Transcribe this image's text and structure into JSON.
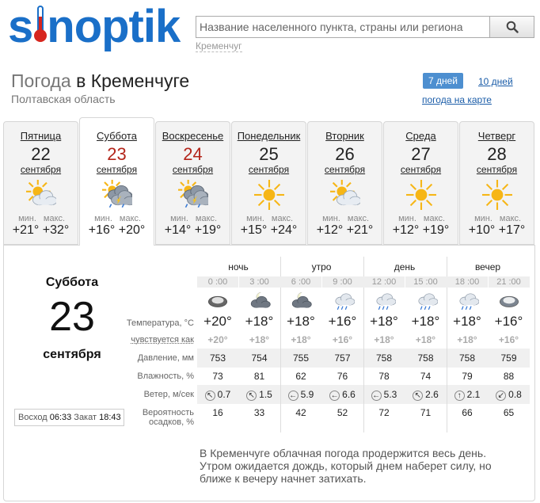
{
  "header": {
    "logo_text": "sinoptik",
    "search_placeholder": "Название населенного пункта, страны или региона",
    "search_hint": "Кременчуг"
  },
  "title": {
    "prefix": "Погода",
    "rest": " в Кременчуге"
  },
  "region": "Полтавская область",
  "view_tabs": {
    "active": "7 дней",
    "other": "10 дней",
    "map": "погода на карте"
  },
  "days": [
    {
      "name": "Пятница",
      "date": "22",
      "month": "сентября",
      "min_label": "мин.",
      "max_label": "макс.",
      "min": "+21°",
      "max": "+32°",
      "icon": "partly-cloudy-icon",
      "weekend": false
    },
    {
      "name": "Суббота",
      "date": "23",
      "month": "сентября",
      "min_label": "мин.",
      "max_label": "макс.",
      "min": "+16°",
      "max": "+20°",
      "icon": "thunderstorm-icon",
      "weekend": true
    },
    {
      "name": "Воскресенье",
      "date": "24",
      "month": "сентября",
      "min_label": "мин.",
      "max_label": "макс.",
      "min": "+14°",
      "max": "+19°",
      "icon": "thunderstorm-icon",
      "weekend": true
    },
    {
      "name": "Понедельник",
      "date": "25",
      "month": "сентября",
      "min_label": "мин.",
      "max_label": "макс.",
      "min": "+15°",
      "max": "+24°",
      "icon": "sun-icon",
      "weekend": false
    },
    {
      "name": "Вторник",
      "date": "26",
      "month": "сентября",
      "min_label": "мин.",
      "max_label": "макс.",
      "min": "+12°",
      "max": "+21°",
      "icon": "partly-cloudy-icon",
      "weekend": false
    },
    {
      "name": "Среда",
      "date": "27",
      "month": "сентября",
      "min_label": "мин.",
      "max_label": "макс.",
      "min": "+12°",
      "max": "+19°",
      "icon": "sun-icon",
      "weekend": false
    },
    {
      "name": "Четверг",
      "date": "28",
      "month": "сентября",
      "min_label": "мин.",
      "max_label": "макс.",
      "min": "+10°",
      "max": "+17°",
      "icon": "sun-icon",
      "weekend": false
    }
  ],
  "selected_day_index": 1,
  "detail": {
    "day_name": "Суббота",
    "date": "23",
    "month": "сентября",
    "sunrise_label": "Восход",
    "sunrise": "06:33",
    "sunset_label": "Закат",
    "sunset": "18:43",
    "periods": [
      "ночь",
      "утро",
      "день",
      "вечер"
    ],
    "hours": [
      "0 :00",
      "3 :00",
      "6 :00",
      "9 :00",
      "12 :00",
      "15 :00",
      "18 :00",
      "21 :00"
    ],
    "icons": [
      "night-cloudy-icon",
      "night-partly-cloudy-icon",
      "night-partly-cloudy-icon",
      "cloud-rain-icon",
      "cloud-rain-icon",
      "cloud-rain-icon",
      "cloud-rain-icon",
      "cloudy-icon"
    ],
    "labels": {
      "temp": "Температура, °C",
      "feels": "чувствуется как",
      "pressure": "Давление, мм",
      "humidity": "Влажность, %",
      "wind": "Ветер, м/сек",
      "precip": "Вероятность осадков, %"
    },
    "temp": [
      "+20°",
      "+18°",
      "+18°",
      "+16°",
      "+18°",
      "+18°",
      "+18°",
      "+16°"
    ],
    "feels": [
      "+20°",
      "+18°",
      "+18°",
      "+16°",
      "+18°",
      "+18°",
      "+18°",
      "+16°"
    ],
    "pressure": [
      "753",
      "754",
      "755",
      "757",
      "758",
      "758",
      "758",
      "759"
    ],
    "humidity": [
      "73",
      "81",
      "62",
      "76",
      "78",
      "74",
      "79",
      "88"
    ],
    "wind": [
      {
        "dir": "↖",
        "speed": "0.7"
      },
      {
        "dir": "↖",
        "speed": "1.5"
      },
      {
        "dir": "←",
        "speed": "5.9"
      },
      {
        "dir": "←",
        "speed": "6.6"
      },
      {
        "dir": "←",
        "speed": "5.3"
      },
      {
        "dir": "↖",
        "speed": "2.6"
      },
      {
        "dir": "↑",
        "speed": "2.1"
      },
      {
        "dir": "↙",
        "speed": "0.8"
      }
    ],
    "precip": [
      "16",
      "33",
      "42",
      "52",
      "72",
      "71",
      "66",
      "65"
    ],
    "description": "В Кременчуге облачная погода продержится весь день. Утром ожидается дождь, который днем наберет силу, но ближе к вечеру начнет затихать."
  }
}
